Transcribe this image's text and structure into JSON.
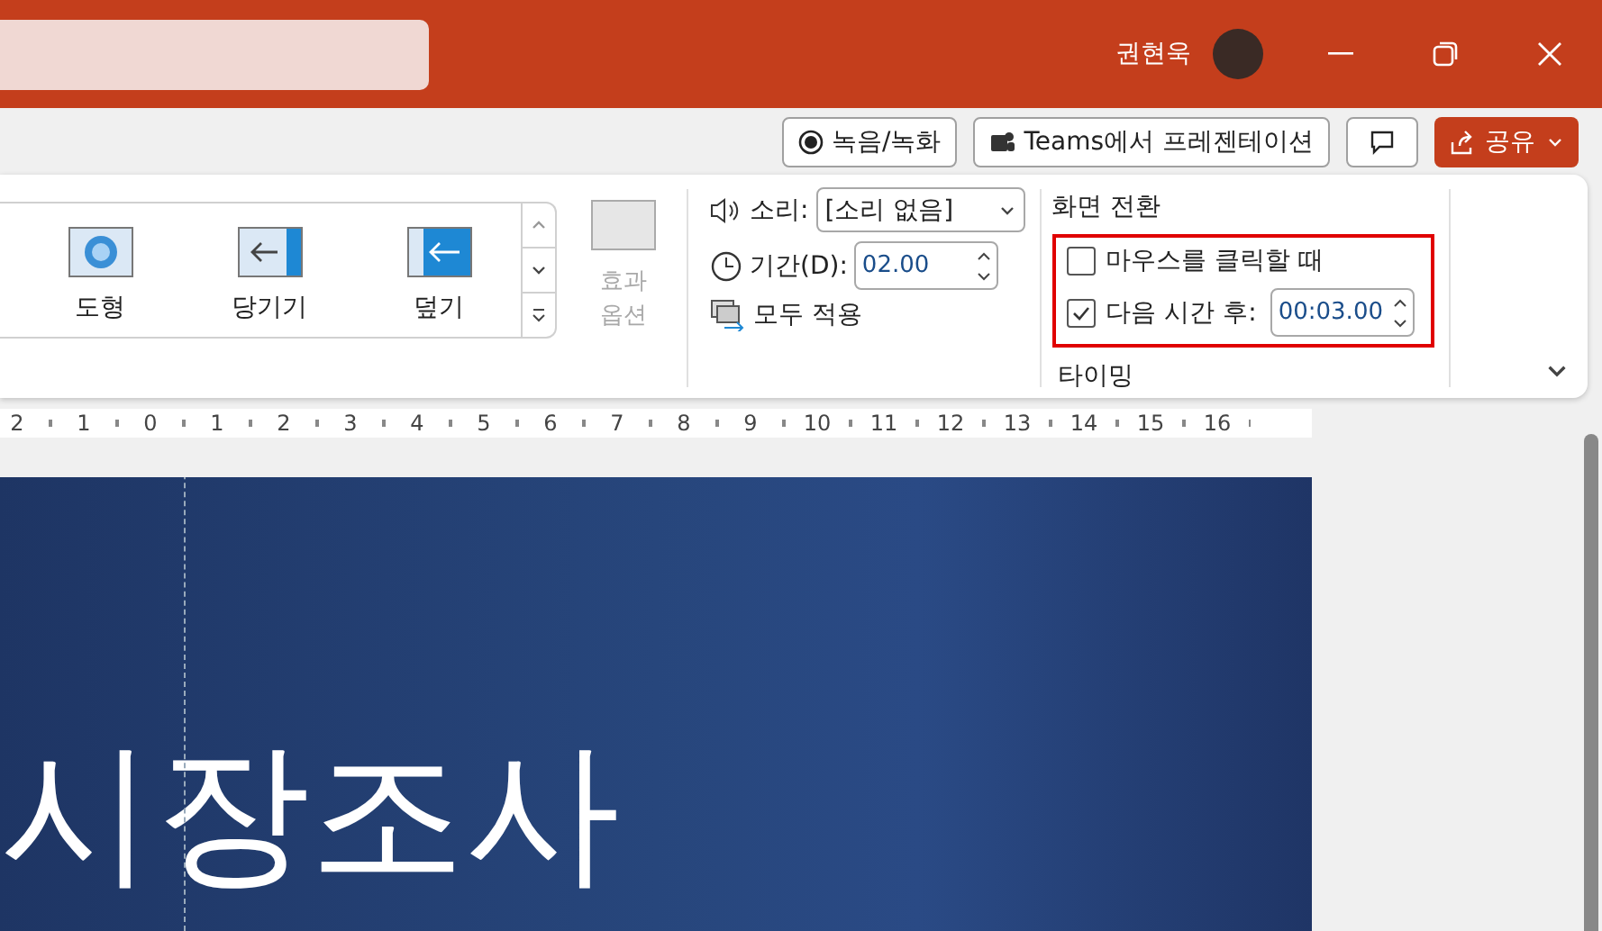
{
  "title_bar": {
    "user_name": "권현욱"
  },
  "command_bar": {
    "record_button": "녹음/녹화",
    "teams_button": "Teams에서 프레젠테이션",
    "share_button": "공유"
  },
  "gallery": {
    "items": [
      {
        "label": "도형",
        "kind": "shape"
      },
      {
        "label": "당기기",
        "kind": "pull"
      },
      {
        "label": "덮기",
        "kind": "cover"
      }
    ],
    "effect_options": "효과\n옵션"
  },
  "timing": {
    "sound_label": "소리:",
    "sound_value": "[소리 없음]",
    "duration_label": "기간(D):",
    "duration_value": "02.00",
    "apply_all": "모두 적용",
    "advance_heading": "화면 전환",
    "on_click": {
      "label": "마우스를 클릭할 때",
      "checked": false
    },
    "after": {
      "label": "다음 시간 후:",
      "checked": true,
      "value": "00:03.00"
    },
    "group_label": "타이밍"
  },
  "ruler": [
    "2",
    "1",
    "0",
    "1",
    "2",
    "3",
    "4",
    "5",
    "6",
    "7",
    "8",
    "9",
    "10",
    "11",
    "12",
    "13",
    "14",
    "15",
    "16"
  ],
  "slide": {
    "title": "시장조사"
  }
}
